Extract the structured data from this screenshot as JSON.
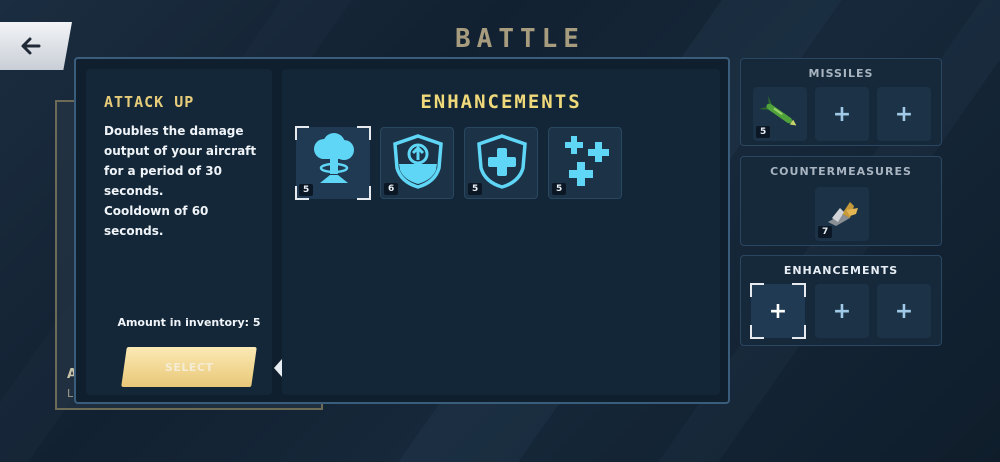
{
  "header": {
    "title": "BATTLE"
  },
  "behind_card": {
    "line1": "A",
    "line2": "L"
  },
  "description": {
    "title": "ATTACK UP",
    "text": "Doubles the damage output of your aircraft for a period of 30 seconds.\nCooldown of 60 seconds.",
    "inventory_label": "Amount in inventory: 5",
    "select_label": "SELECT"
  },
  "enhancements_panel": {
    "title": "ENHANCEMENTS",
    "items": [
      {
        "icon": "mushroom-cloud-icon",
        "count": "5",
        "selected": true
      },
      {
        "icon": "shield-arrow-up-icon",
        "count": "6",
        "selected": false
      },
      {
        "icon": "shield-plus-icon",
        "count": "5",
        "selected": false
      },
      {
        "icon": "triple-plus-icon",
        "count": "5",
        "selected": false
      }
    ]
  },
  "loadout": {
    "missiles": {
      "title": "MISSILES",
      "slots": [
        {
          "icon": "missile-icon",
          "count": "5"
        },
        {
          "icon": "plus-icon",
          "label": "+"
        },
        {
          "icon": "plus-icon",
          "label": "+"
        }
      ]
    },
    "countermeasures": {
      "title": "COUNTERMEASURES",
      "slots": [
        {
          "icon": "flare-icon",
          "count": "7"
        }
      ]
    },
    "enhancements": {
      "title": "ENHANCEMENTS",
      "slots": [
        {
          "icon": "plus-icon",
          "label": "+"
        },
        {
          "icon": "plus-icon",
          "label": "+"
        },
        {
          "icon": "plus-icon",
          "label": "+"
        }
      ]
    }
  },
  "colors": {
    "accent_gold": "#efd97a",
    "icon_cyan": "#5fd6f5",
    "button_gold": "#f2d98f"
  }
}
